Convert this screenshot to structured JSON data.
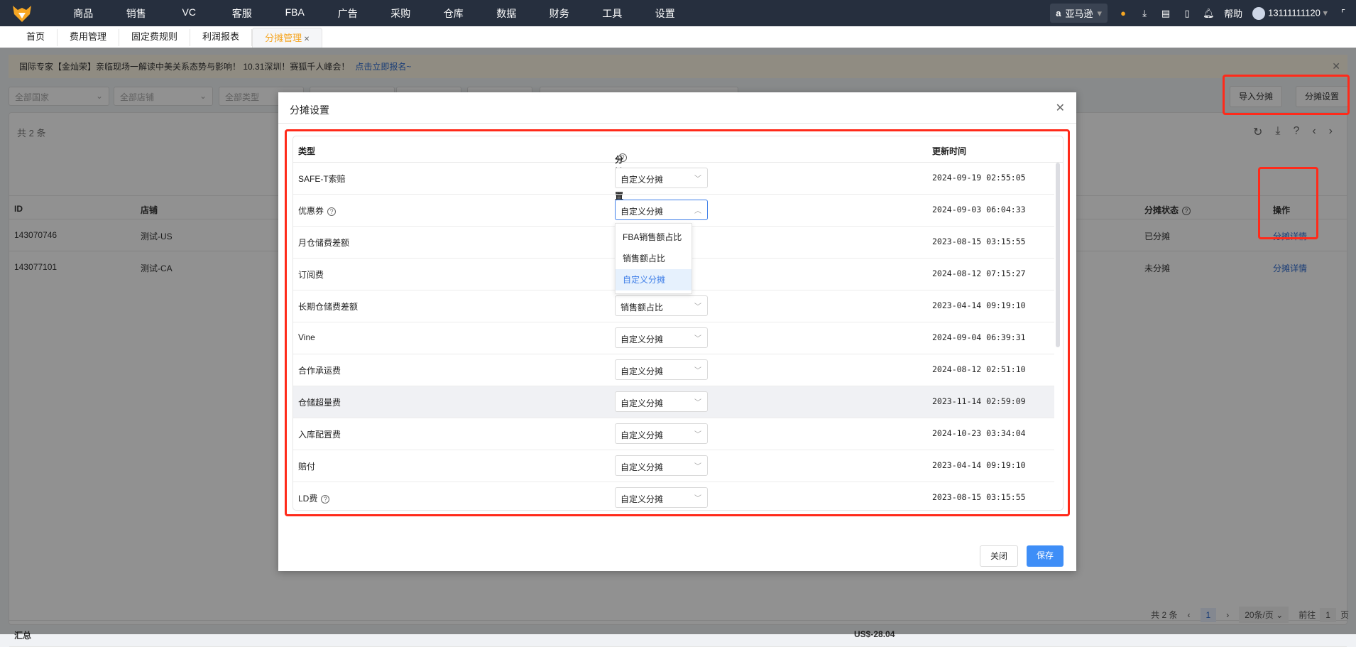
{
  "topnav": {
    "items": [
      "商品",
      "销售",
      "VC",
      "客服",
      "FBA",
      "广告",
      "采购",
      "仓库",
      "数据",
      "财务",
      "工具",
      "设置"
    ],
    "marketplace": "亚马逊",
    "help": "帮助",
    "user": "13111111120"
  },
  "tabs": [
    "首页",
    "费用管理",
    "固定费规则",
    "利润报表",
    "分摊管理"
  ],
  "banner": {
    "text": "国际专家【金灿荣】亲临现场一解读中美关系态势与影响！ 10.31深圳！赛狐千人峰会！",
    "link": "点击立即报名~"
  },
  "filters": [
    "全部国家",
    "全部店铺",
    "全部类型"
  ],
  "actions": {
    "import": "导入分摊",
    "settings": "分摊设置"
  },
  "main_table": {
    "count": "共 2 条",
    "headers": {
      "id": "ID",
      "store": "店铺",
      "status": "分摊状态",
      "op": "操作"
    },
    "rows": [
      {
        "id": "143070746",
        "store": "测试-US",
        "status": "已分摊",
        "op": "分摊详情"
      },
      {
        "id": "143077101",
        "store": "测试-CA",
        "status": "未分摊",
        "op": "分摊详情"
      }
    ],
    "summary_label": "汇总",
    "summary_value": "US$-28.04"
  },
  "pager": {
    "total": "共 2 条",
    "page": "1",
    "size": "20条/页",
    "goto": "前往",
    "goto_value": "1",
    "page_unit": "页"
  },
  "modal": {
    "title": "分摊设置",
    "headers": {
      "type": "类型",
      "setting": "分摊设置",
      "time": "更新时间"
    },
    "rows": [
      {
        "type": "SAFE-T索赔",
        "setting": "自定义分摊",
        "time": "2024-09-19 02:55:05"
      },
      {
        "type": "优惠券",
        "help": true,
        "setting": "自定义分摊",
        "time": "2024-09-03 06:04:33",
        "open": true
      },
      {
        "type": "月仓储费差额",
        "setting": "",
        "time": "2023-08-15 03:15:55"
      },
      {
        "type": "订阅费",
        "setting": "",
        "time": "2024-08-12 07:15:27"
      },
      {
        "type": "长期仓储费差额",
        "setting": "销售额占比",
        "time": "2023-04-14 09:19:10"
      },
      {
        "type": "Vine",
        "setting": "自定义分摊",
        "time": "2024-09-04 06:39:31"
      },
      {
        "type": "合作承运费",
        "setting": "自定义分摊",
        "time": "2024-08-12 02:51:10"
      },
      {
        "type": "仓储超量费",
        "setting": "自定义分摊",
        "time": "2023-11-14 02:59:09",
        "hover": true
      },
      {
        "type": "入库配置费",
        "setting": "自定义分摊",
        "time": "2024-10-23 03:34:04"
      },
      {
        "type": "赔付",
        "setting": "自定义分摊",
        "time": "2023-04-14 09:19:10"
      },
      {
        "type": "LD费",
        "help": true,
        "setting": "自定义分摊",
        "time": "2023-08-15 03:15:55"
      }
    ],
    "dropdown_options": [
      "FBA销售额占比",
      "销售额占比",
      "自定义分摊"
    ],
    "dropdown_selected": "自定义分摊",
    "close": "关闭",
    "save": "保存"
  },
  "colors": {
    "accent": "#3e7ee8",
    "highlight": "#ff2a1a",
    "nav": "#262f3e",
    "tab_active": "#f5a623"
  }
}
